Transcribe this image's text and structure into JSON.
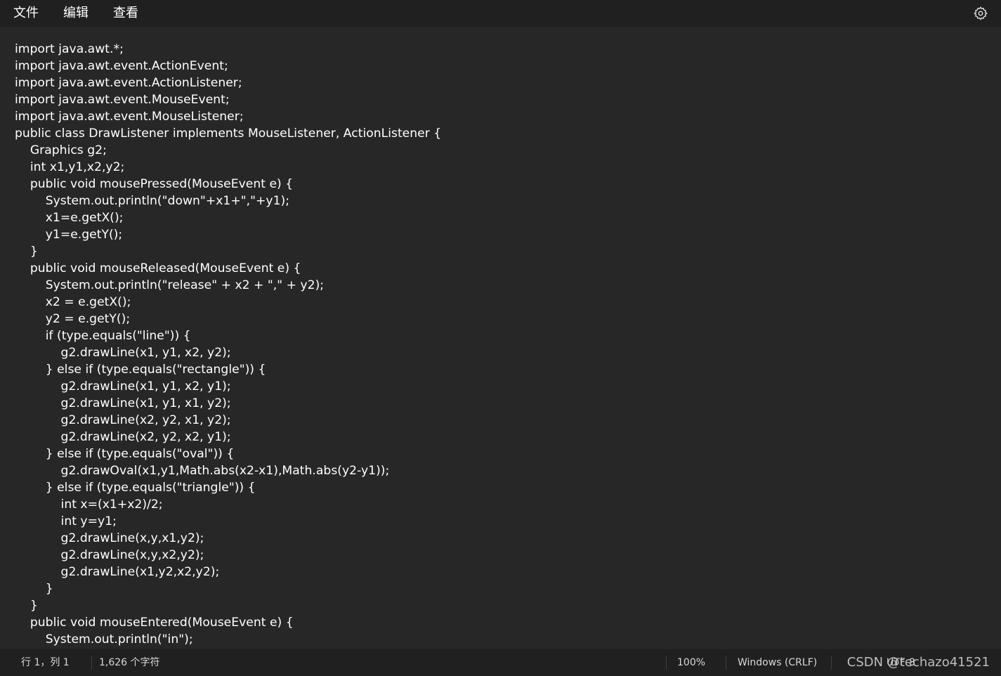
{
  "menu": {
    "file": "文件",
    "edit": "编辑",
    "view": "查看"
  },
  "icons": {
    "settings": "gear-icon"
  },
  "editor": {
    "lines": [
      "import java.awt.*;",
      "import java.awt.event.ActionEvent;",
      "import java.awt.event.ActionListener;",
      "import java.awt.event.MouseEvent;",
      "import java.awt.event.MouseListener;",
      "public class DrawListener implements MouseListener, ActionListener {",
      "    Graphics g2;",
      "    int x1,y1,x2,y2;",
      "    public void mousePressed(MouseEvent e) {",
      "        System.out.println(\"down\"+x1+\",\"+y1);",
      "        x1=e.getX();",
      "        y1=e.getY();",
      "    }",
      "    public void mouseReleased(MouseEvent e) {",
      "        System.out.println(\"release\" + x2 + \",\" + y2);",
      "        x2 = e.getX();",
      "        y2 = e.getY();",
      "        if (type.equals(\"line\")) {",
      "            g2.drawLine(x1, y1, x2, y2);",
      "        } else if (type.equals(\"rectangle\")) {",
      "            g2.drawLine(x1, y1, x2, y1);",
      "            g2.drawLine(x1, y1, x1, y2);",
      "            g2.drawLine(x2, y2, x1, y2);",
      "            g2.drawLine(x2, y2, x2, y1);",
      "        } else if (type.equals(\"oval\")) {",
      "            g2.drawOval(x1,y1,Math.abs(x2-x1),Math.abs(y2-y1));",
      "        } else if (type.equals(\"triangle\")) {",
      "            int x=(x1+x2)/2;",
      "            int y=y1;",
      "            g2.drawLine(x,y,x1,y2);",
      "            g2.drawLine(x,y,x2,y2);",
      "            g2.drawLine(x1,y2,x2,y2);",
      "        }",
      "    }",
      "    public void mouseEntered(MouseEvent e) {",
      "        System.out.println(\"in\");"
    ]
  },
  "status": {
    "position": "行 1，列 1",
    "char_count": "1,626 个字符",
    "zoom": "100%",
    "line_ending": "Windows (CRLF)",
    "encoding": "UTF-8",
    "watermark": "CSDN @techazo41521"
  }
}
